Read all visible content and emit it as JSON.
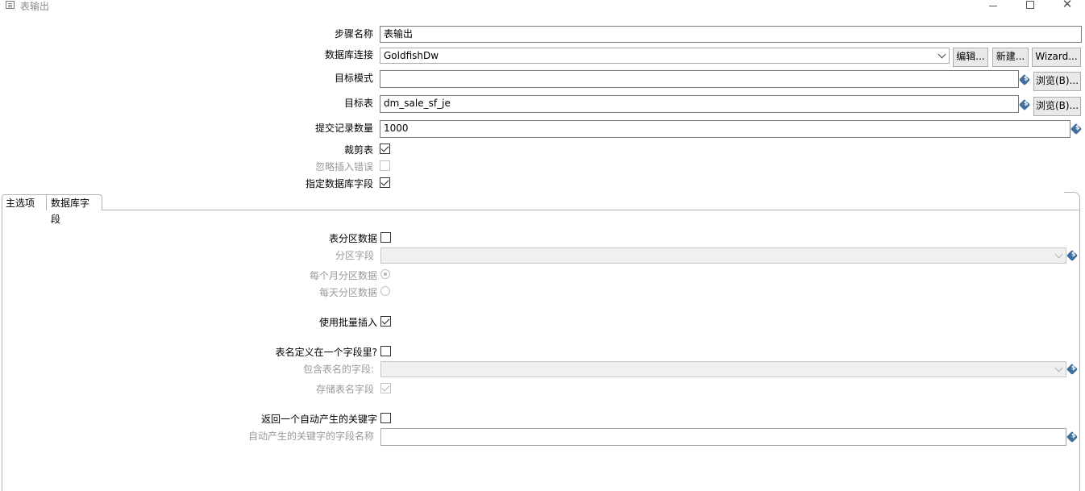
{
  "window": {
    "title": "表输出"
  },
  "form": {
    "step_name_label": "步骤名称",
    "step_name_value": "表输出",
    "db_conn_label": "数据库连接",
    "db_conn_value": "GoldfishDw",
    "edit_label": "编辑...",
    "new_label": "新建...",
    "wizard_label": "Wizard...",
    "target_schema_label": "目标模式",
    "target_schema_value": "",
    "browse_label": "浏览(B)...",
    "target_table_label": "目标表",
    "target_table_value": "dm_sale_sf_je",
    "commit_size_label": "提交记录数量",
    "commit_size_value": "1000",
    "truncate_label": "裁剪表",
    "truncate_checked": true,
    "ignore_errors_label": "忽略插入错误",
    "ignore_errors_checked": false,
    "specify_fields_label": "指定数据库字段",
    "specify_fields_checked": true
  },
  "tabs": [
    {
      "label": "主选项",
      "active": true
    },
    {
      "label": "数据库字段",
      "active": false
    }
  ],
  "main": {
    "partition_label": "表分区数据",
    "partition_field_label": "分区字段",
    "partition_monthly_label": "每个月分区数据",
    "partition_daily_label": "每天分区数据",
    "batch_insert_label": "使用批量插入",
    "batch_insert_checked": true,
    "tablename_in_field_label": "表名定义在一个字段里?",
    "tablename_field_label": "包含表名的字段:",
    "store_tablename_label": "存储表名字段",
    "return_key_label": "返回一个自动产生的关键字",
    "key_field_label": "自动产生的关键字的字段名称"
  },
  "icons": {
    "variable": "variable-dollar-icon",
    "window": "table-output-icon"
  },
  "colors": {
    "variable_icon": "#3d6e9c",
    "disabled_text": "#9a9a9a"
  }
}
